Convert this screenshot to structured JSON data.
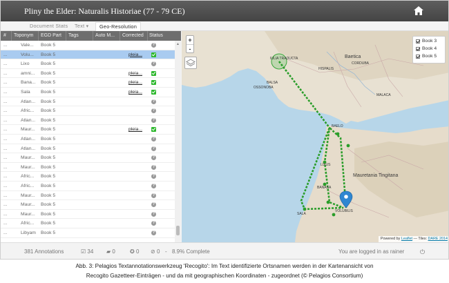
{
  "header": {
    "title": "Pliny the Elder: Naturalis Historiae (77 - 79 CE)",
    "home_icon": "home-icon"
  },
  "tabs": [
    {
      "label": "Document Stats"
    },
    {
      "label": "Text ▾"
    },
    {
      "label": "Geo-Resolution",
      "active": true
    }
  ],
  "table": {
    "columns": [
      "#",
      "Toponym",
      "EGD Part",
      "Tags",
      "Auto M...",
      "Corrected",
      "Status"
    ],
    "rows": [
      {
        "toponym": "Vale...",
        "part": "Book 5",
        "corrected": "",
        "status": "unverified"
      },
      {
        "toponym": "Volu...",
        "part": "Book 5",
        "corrected": "pleia...",
        "status": "verified",
        "selected": true
      },
      {
        "toponym": "Lixo",
        "part": "Book 5",
        "corrected": "",
        "status": "unverified"
      },
      {
        "toponym": "amni...",
        "part": "Book 5",
        "corrected": "pleia...",
        "status": "verified"
      },
      {
        "toponym": "Bana...",
        "part": "Book 5",
        "corrected": "pleia...",
        "status": "verified"
      },
      {
        "toponym": "Sala",
        "part": "Book 5",
        "corrected": "pleia...",
        "status": "verified"
      },
      {
        "toponym": "Atlan...",
        "part": "Book 5",
        "corrected": "",
        "status": "unverified"
      },
      {
        "toponym": "Afric...",
        "part": "Book 5",
        "corrected": "",
        "status": "unverified"
      },
      {
        "toponym": "Atlan...",
        "part": "Book 5",
        "corrected": "",
        "status": "unverified"
      },
      {
        "toponym": "Maur...",
        "part": "Book 5",
        "corrected": "pleia...",
        "status": "verified"
      },
      {
        "toponym": "Atlan...",
        "part": "Book 5",
        "corrected": "",
        "status": "unverified"
      },
      {
        "toponym": "Atlan...",
        "part": "Book 5",
        "corrected": "",
        "status": "unverified"
      },
      {
        "toponym": "Maur...",
        "part": "Book 5",
        "corrected": "",
        "status": "unverified"
      },
      {
        "toponym": "Maur...",
        "part": "Book 5",
        "corrected": "",
        "status": "unverified"
      },
      {
        "toponym": "Afric...",
        "part": "Book 5",
        "corrected": "",
        "status": "unverified"
      },
      {
        "toponym": "Afric...",
        "part": "Book 5",
        "corrected": "",
        "status": "unverified"
      },
      {
        "toponym": "Maur...",
        "part": "Book 5",
        "corrected": "",
        "status": "unverified"
      },
      {
        "toponym": "Maur...",
        "part": "Book 5",
        "corrected": "",
        "status": "unverified"
      },
      {
        "toponym": "Maur...",
        "part": "Book 5",
        "corrected": "",
        "status": "unverified"
      },
      {
        "toponym": "Afric...",
        "part": "Book 5",
        "corrected": "",
        "status": "unverified"
      },
      {
        "toponym": "Libyam",
        "part": "Book 5",
        "corrected": "",
        "status": "unverified"
      }
    ]
  },
  "map": {
    "zoom_in": "+",
    "zoom_out": "-",
    "legend": [
      {
        "label": "Book 3"
      },
      {
        "label": "Book 4"
      },
      {
        "label": "Book 5"
      }
    ],
    "places": [
      "IULIA TRADUCTA",
      "BALSA",
      "OSSONOBA",
      "BAELO",
      "LIXUS",
      "BANASA",
      "SALA",
      "VOLUBILIS",
      "Baetica",
      "HISPALIS",
      "CORDUBA",
      "MALACA"
    ],
    "region_label": "Mauretania Tingitana",
    "attribution_prefix": "Powered by ",
    "attribution_leaflet": "Leaflet",
    "attribution_tiles": " — Tiles: ",
    "attribution_dare": "DARE 2014",
    "colors": {
      "route": "#2a9d2a",
      "marker": "#2f86d1",
      "sea": "#b7d6e9"
    }
  },
  "footer": {
    "annotations": "381 Annotations",
    "verified": "34",
    "comments": "0",
    "unverified": "0",
    "disabled": "0",
    "sep": "-",
    "complete": "8.9% Complete",
    "login": "You are logged in as rainer",
    "power_icon": "power-icon"
  },
  "caption": {
    "line1": "Abb. 3: Pelagios Textannotationswerkzeug 'Recogito': Im Text identifizierte Ortsnamen werden in der Kartenansicht von",
    "line2": "Recogito Gazetteer-Einträgen - und da mit geographischen Koordinaten - zugeordnet (© Pelagios Consortium)"
  }
}
